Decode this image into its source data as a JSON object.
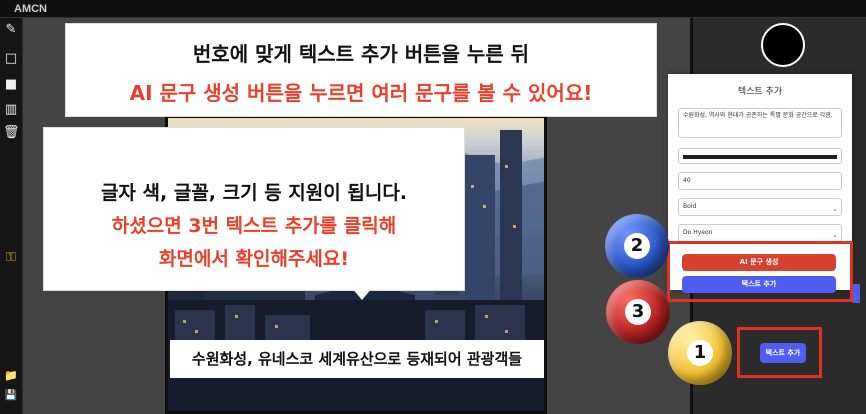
{
  "app": {
    "title": "AMCN"
  },
  "toolbar": {
    "tools": [
      {
        "name": "pencil-tool-icon",
        "glyph": "✎"
      },
      {
        "name": "rectangle-outline-tool-icon",
        "glyph": "□"
      },
      {
        "name": "filled-rectangle-tool-icon",
        "glyph": "■"
      },
      {
        "name": "pattern-tool-icon",
        "glyph": "▥"
      },
      {
        "name": "trash-icon",
        "glyph": "🗑"
      },
      {
        "name": "key-icon",
        "glyph": "⚿"
      },
      {
        "name": "folder-icon",
        "glyph": "📁"
      },
      {
        "name": "save-icon",
        "glyph": "💾"
      }
    ]
  },
  "canvas": {
    "caption": "수원화성, 유네스코 세계유산으로 등재되어 관광객들"
  },
  "callouts": {
    "top": {
      "line1": "번호에 맞게 텍스트 추가 버튼을 누른 뒤",
      "line2": "AI 문구 생성 버튼을 누르면 여러 문구를 볼 수 있어요!"
    },
    "left": {
      "line1": "글자 색, 글꼴, 크기 등 지원이 됩니다.",
      "line2": "하셨으면 3번 텍스트 추가를 클릭해",
      "line3": "화면에서 확인해주세요!"
    }
  },
  "panel": {
    "title": "텍스트 추가",
    "text_value": "수원화성, 역사와 현대가 공존하는 특별 문화 공간으로 각광.",
    "color_value": "#1a1a1a",
    "size_value": "40",
    "weight_value": "Bold",
    "font_value": "Do Hyeon",
    "ai_button": "AI 문구 생성",
    "add_button": "텍스트 추가"
  },
  "side": {
    "add_button": "텍스트 추가"
  },
  "markers": [
    "1",
    "2",
    "3"
  ],
  "colors": {
    "accent_red": "#e0331f",
    "button_blue": "#4f5df2",
    "ai_button_red": "#d6402e",
    "ball1": "#f1c232",
    "ball2": "#2b58c7",
    "ball3": "#b62422"
  }
}
